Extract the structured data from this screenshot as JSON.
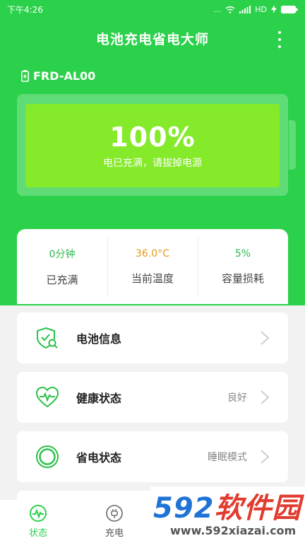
{
  "status_bar": {
    "time": "下午4:26",
    "dots": "...",
    "network": "HD"
  },
  "app": {
    "title": "电池充电省电大师"
  },
  "device": {
    "name": "FRD-AL00"
  },
  "battery": {
    "percent_label": "100%",
    "level": 1.0,
    "message": "电已充满，请拔掉电源"
  },
  "stats": [
    {
      "value": "0分钟",
      "label": "已充满",
      "color": "#2bb84a"
    },
    {
      "value": "36.0°C",
      "label": "当前温度",
      "color": "#e39b1a"
    },
    {
      "value": "5%",
      "label": "容量损耗",
      "color": "#2bb84a"
    }
  ],
  "menu": [
    {
      "title": "电池信息",
      "value": "",
      "icon": "battery-shield-icon"
    },
    {
      "title": "健康状态",
      "value": "良好",
      "icon": "heart-pulse-icon"
    },
    {
      "title": "省电状态",
      "value": "睡眠模式",
      "icon": "power-ring-icon"
    }
  ],
  "tabs": [
    {
      "label": "状态",
      "icon": "status-pulse-icon",
      "active": true
    },
    {
      "label": "充电",
      "icon": "plug-icon",
      "active": false
    }
  ],
  "watermark": {
    "brand_num": "592",
    "brand_text": "软件园",
    "url": "www.592xiazai.com"
  },
  "colors": {
    "primary": "#2bd14a",
    "battery_fill": "#84ea2a",
    "temp": "#e39b1a"
  }
}
